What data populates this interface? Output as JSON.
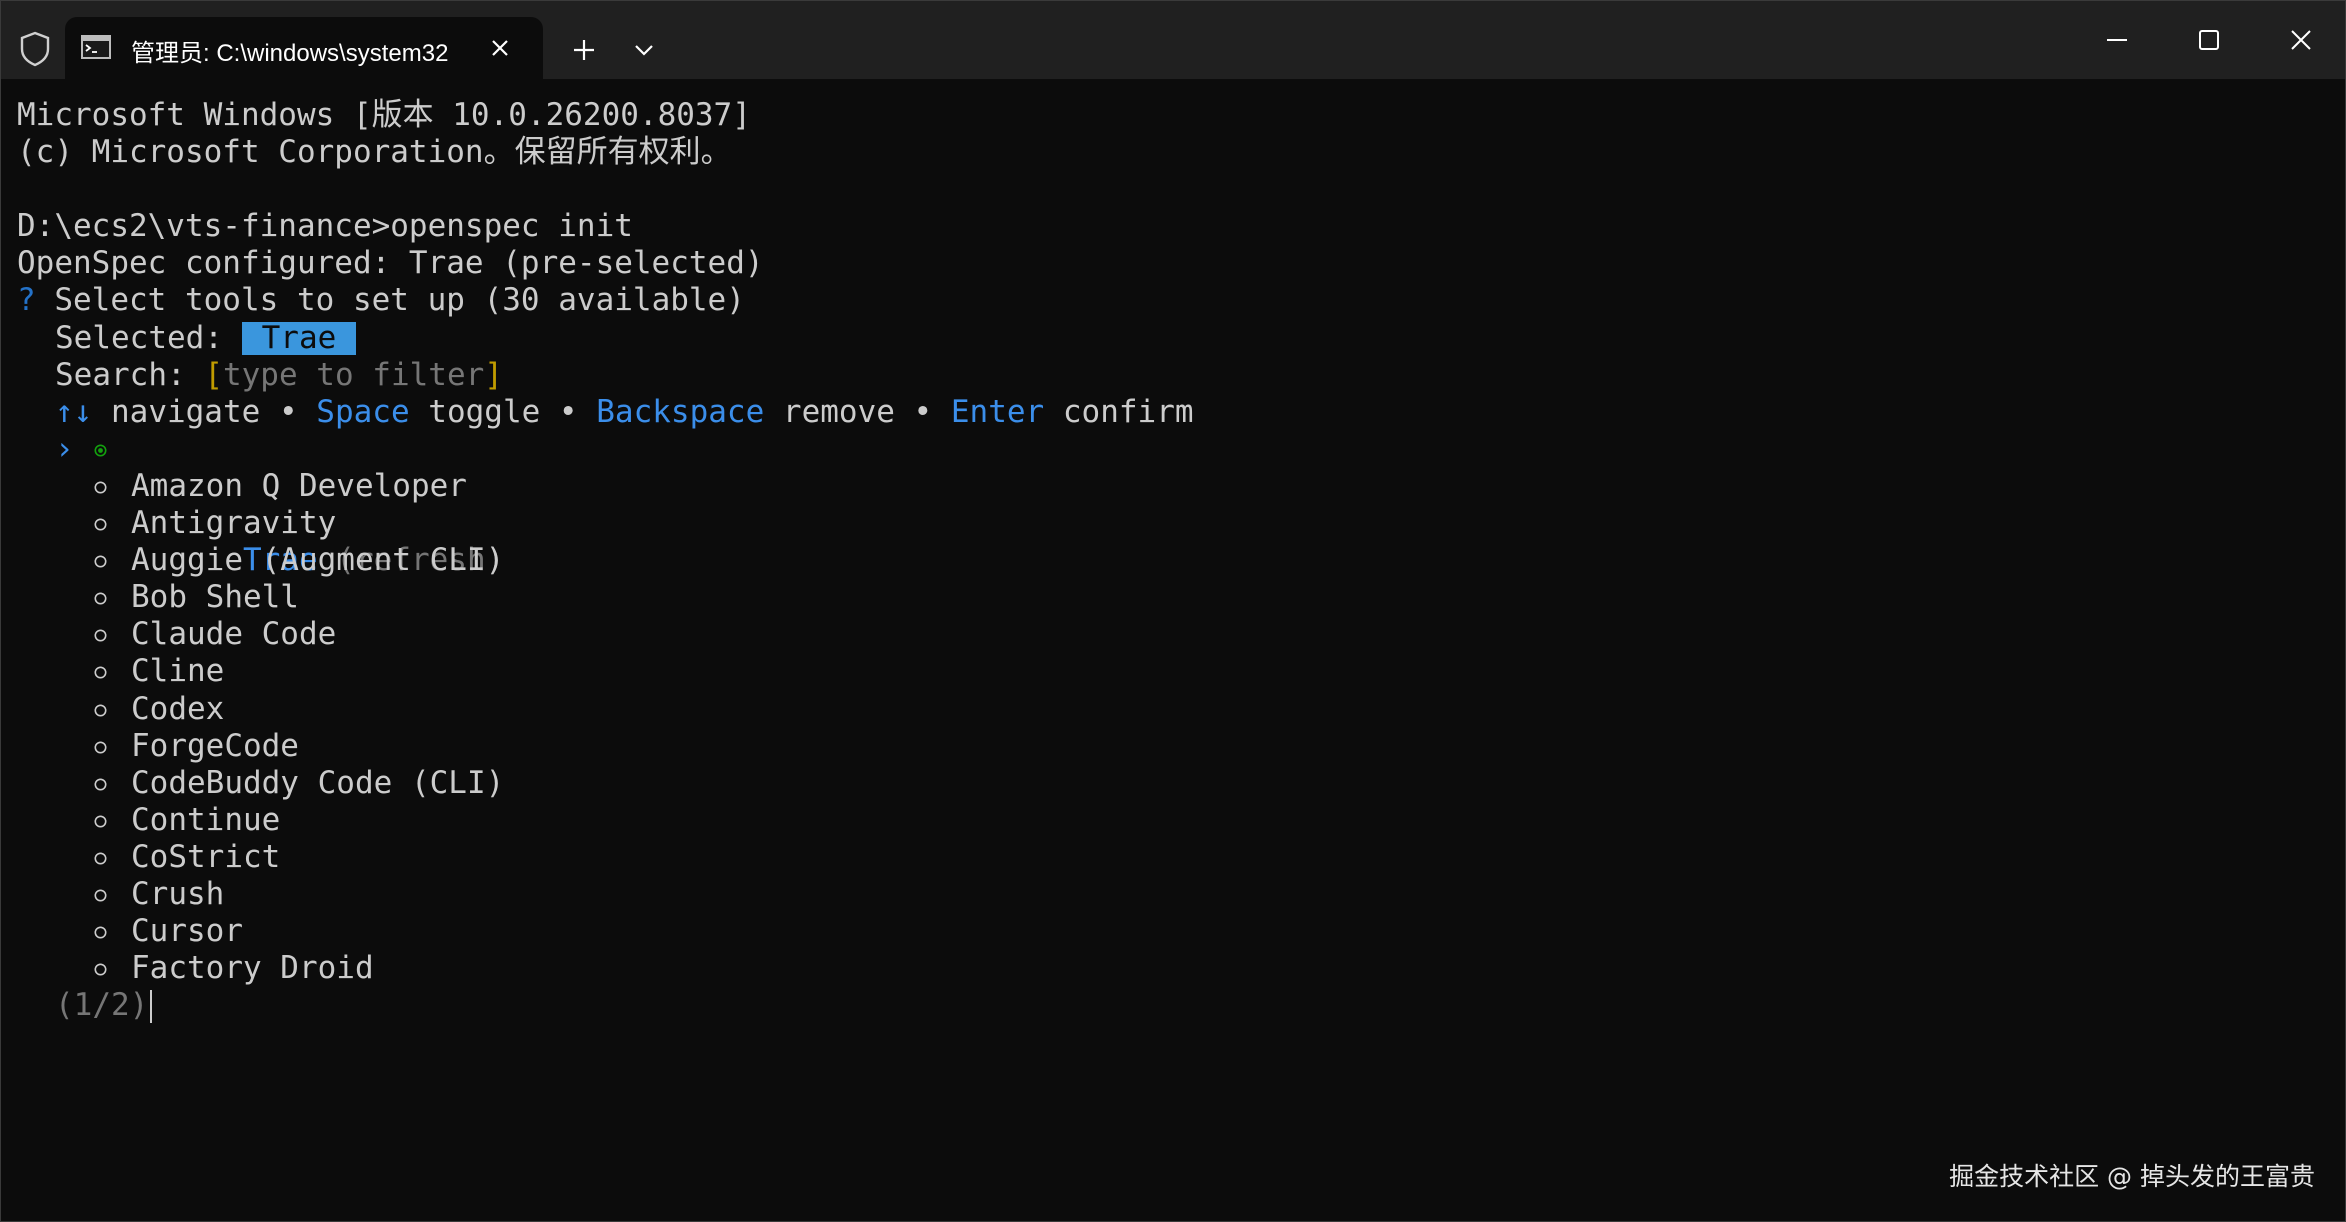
{
  "window": {
    "tab_title": "管理员: C:\\windows\\system32",
    "accent_color": "#3a96dd"
  },
  "icons": {
    "shield": "shield-icon",
    "terminal": "terminal-icon",
    "close_tab": "close-icon",
    "new_tab": "plus-icon",
    "dropdown": "chevron-down-icon",
    "minimize": "minimize-icon",
    "maximize": "maximize-icon",
    "close_window": "close-icon"
  },
  "terminal": {
    "header_line1": "Microsoft Windows [版本 10.0.26200.8037]",
    "header_line2": "(c) Microsoft Corporation。保留所有权利。",
    "prompt_command": "D:\\ecs2\\vts-finance>openspec init",
    "configured_line": "OpenSpec configured: Trae (pre-selected)",
    "question_mark": "?",
    "question_text": " Select tools to set up (30 available)",
    "selected_label": "Selected: ",
    "selected_value": "Trae",
    "search_label": "Search: ",
    "search_open_bracket": "[",
    "search_placeholder": "type to filter",
    "search_close_bracket": "]",
    "help": {
      "arrows": "↑↓",
      "navigate": " navigate • ",
      "space": "Space",
      "toggle": " toggle • ",
      "backspace": "Backspace",
      "remove": " remove • ",
      "enter": "Enter",
      "confirm": " confirm"
    },
    "active_item": {
      "arrow": "›",
      "name": "Trae",
      "note": " (refresh)"
    },
    "items": [
      "Amazon Q Developer",
      "Antigravity",
      "Auggie (Augment CLI)",
      "Bob Shell",
      "Claude Code",
      "Cline",
      "Codex",
      "ForgeCode",
      "CodeBuddy Code (CLI)",
      "Continue",
      "CoStrict",
      "Crush",
      "Cursor",
      "Factory Droid"
    ],
    "page_indicator": "(1/2)"
  },
  "watermark": "掘金技术社区 @ 掉头发的王富贵"
}
